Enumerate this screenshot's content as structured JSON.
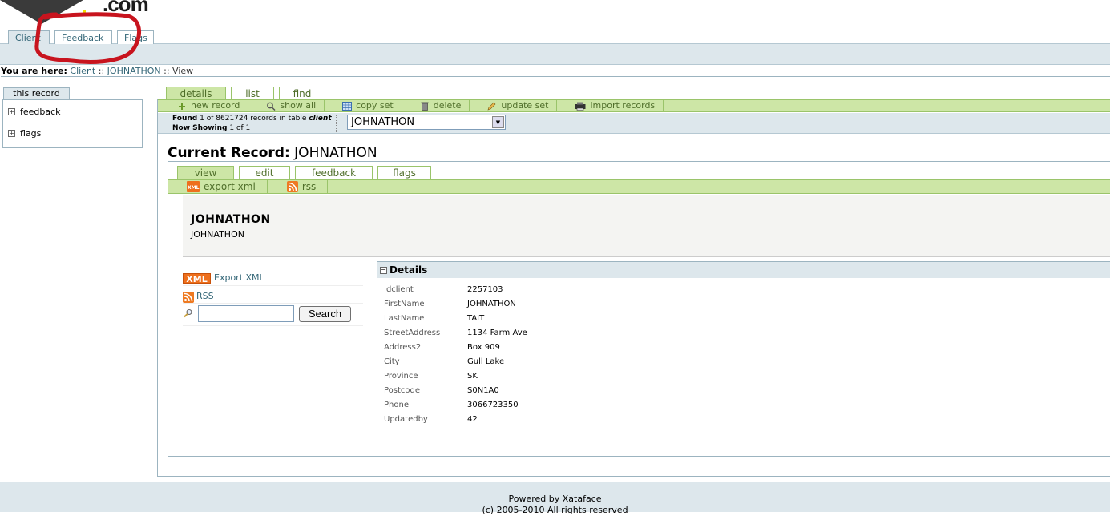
{
  "logo": {
    "text": ".com"
  },
  "top_tabs": [
    {
      "label": "Client",
      "selected": true
    },
    {
      "label": "Feedback",
      "selected": false
    },
    {
      "label": "Flags",
      "selected": false
    }
  ],
  "breadcrumb": {
    "prefix": "You are here:",
    "items": [
      "Client",
      "JOHNATHON",
      "View"
    ],
    "separator": "::"
  },
  "sidebar": {
    "tab": "this record",
    "items": [
      {
        "label": "feedback"
      },
      {
        "label": "flags"
      }
    ]
  },
  "table_tabs": [
    {
      "label": "details",
      "selected": true
    },
    {
      "label": "list",
      "selected": false
    },
    {
      "label": "find",
      "selected": false
    }
  ],
  "actions": [
    {
      "label": "new record",
      "icon": "new-record-icon"
    },
    {
      "label": "show all",
      "icon": "show-all-icon"
    },
    {
      "label": "copy set",
      "icon": "copy-set-icon"
    },
    {
      "label": "delete",
      "icon": "delete-icon"
    },
    {
      "label": "update set",
      "icon": "update-set-icon"
    },
    {
      "label": "import records",
      "icon": "import-records-icon"
    }
  ],
  "result": {
    "found_label": "Found",
    "found_num": "1",
    "of_text": "of",
    "total": "8621724",
    "records_text": "records in table",
    "table": "client",
    "showing_label": "Now Showing",
    "showing_from": "1",
    "showing_to": "1",
    "select_value": "JOHNATHON"
  },
  "current_record": {
    "label": "Current Record:",
    "value": "JOHNATHON"
  },
  "record_tabs": [
    {
      "label": "view",
      "selected": true
    },
    {
      "label": "edit",
      "selected": false
    },
    {
      "label": "feedback",
      "selected": false
    },
    {
      "label": "flags",
      "selected": false
    }
  ],
  "record_actions": [
    {
      "label": "export xml",
      "icon": "xml-icon"
    },
    {
      "label": "rss",
      "icon": "rss-icon"
    }
  ],
  "record_head": {
    "title": "JOHNATHON",
    "subtitle": "JOHNATHON"
  },
  "left_actions": {
    "xml_badge": "XML",
    "export_xml": "Export XML",
    "rss": "RSS",
    "search_placeholder": "",
    "search_button": "Search"
  },
  "details": {
    "title": "Details",
    "fields": [
      {
        "label": "Idclient",
        "value": "2257103"
      },
      {
        "label": "FirstName",
        "value": "JOHNATHON"
      },
      {
        "label": "LastName",
        "value": "TAIT"
      },
      {
        "label": "StreetAddress",
        "value": "1134 Farm Ave"
      },
      {
        "label": "Address2",
        "value": "Box 909"
      },
      {
        "label": "City",
        "value": "Gull Lake"
      },
      {
        "label": "Province",
        "value": "SK"
      },
      {
        "label": "Postcode",
        "value": "S0N1A0"
      },
      {
        "label": "Phone",
        "value": "3066723350"
      },
      {
        "label": "Updatedby",
        "value": "42"
      }
    ]
  },
  "footer": {
    "line1": "Powered by Xataface",
    "line2": "(c) 2005-2010 All rights reserved"
  },
  "colors": {
    "accent_green": "#cde6a6",
    "band_blue": "#dde7ec",
    "link": "#336677",
    "annotation_red": "#c8141e"
  }
}
